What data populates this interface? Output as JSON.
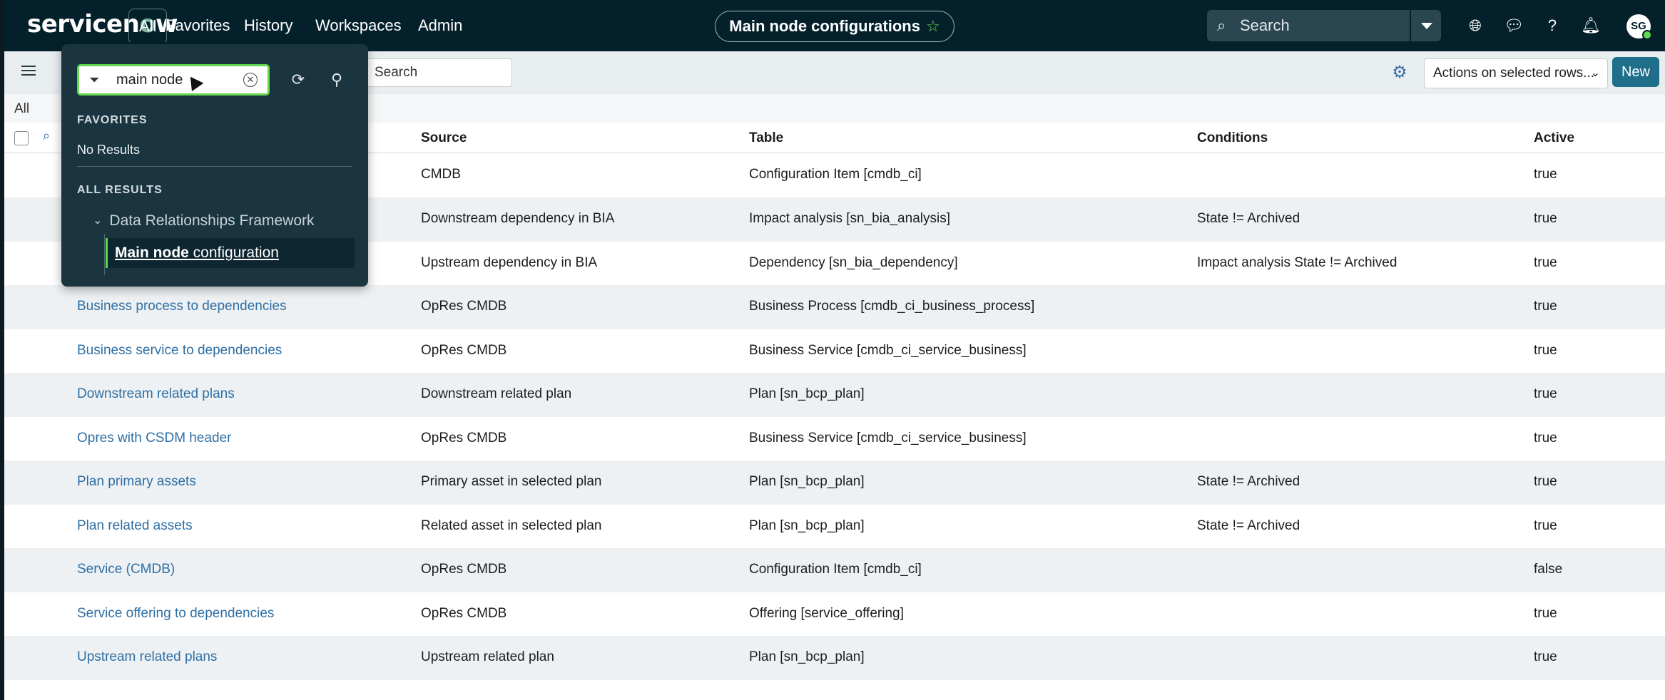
{
  "topnav": {
    "brand": "servicenow",
    "tabs": [
      {
        "label": "All"
      },
      {
        "label": "Favorites"
      },
      {
        "label": "History"
      },
      {
        "label": "Workspaces"
      },
      {
        "label": "Admin"
      }
    ],
    "page_title": "Main node configurations",
    "search_placeholder": "Search",
    "avatar_initials": "SG"
  },
  "toolbar": {
    "list_search_placeholder": "Search",
    "actions_label": "Actions on selected rows...",
    "new_label": "New"
  },
  "breadcrumb": "All",
  "table": {
    "headers": [
      "Source",
      "Table",
      "Conditions",
      "Active"
    ],
    "rows": [
      {
        "name": "",
        "source": "CMDB",
        "table": "Configuration Item [cmdb_ci]",
        "conditions": "",
        "active": "true"
      },
      {
        "name": "",
        "source": "Downstream dependency in BIA",
        "table": "Impact analysis [sn_bia_analysis]",
        "conditions": "State != Archived",
        "active": "true"
      },
      {
        "name": "",
        "source": "Upstream dependency in BIA",
        "table": "Dependency [sn_bia_dependency]",
        "conditions": "Impact analysis State != Archived",
        "active": "true"
      },
      {
        "name": "Business process to dependencies",
        "source": "OpRes CMDB",
        "table": "Business Process [cmdb_ci_business_process]",
        "conditions": "",
        "active": "true"
      },
      {
        "name": "Business service to dependencies",
        "source": "OpRes CMDB",
        "table": "Business Service [cmdb_ci_service_business]",
        "conditions": "",
        "active": "true"
      },
      {
        "name": "Downstream related plans",
        "source": "Downstream related plan",
        "table": "Plan [sn_bcp_plan]",
        "conditions": "",
        "active": "true"
      },
      {
        "name": "Opres with CSDM header",
        "source": "OpRes CMDB",
        "table": "Business Service [cmdb_ci_service_business]",
        "conditions": "",
        "active": "true"
      },
      {
        "name": "Plan primary assets",
        "source": "Primary asset in selected plan",
        "table": "Plan [sn_bcp_plan]",
        "conditions": "State != Archived",
        "active": "true"
      },
      {
        "name": "Plan related assets",
        "source": "Related asset in selected plan",
        "table": "Plan [sn_bcp_plan]",
        "conditions": "State != Archived",
        "active": "true"
      },
      {
        "name": "Service (CMDB)",
        "source": "OpRes CMDB",
        "table": "Configuration Item [cmdb_ci]",
        "conditions": "",
        "active": "false"
      },
      {
        "name": "Service offering to dependencies",
        "source": "OpRes CMDB",
        "table": "Offering [service_offering]",
        "conditions": "",
        "active": "true"
      },
      {
        "name": "Upstream related plans",
        "source": "Upstream related plan",
        "table": "Plan [sn_bcp_plan]",
        "conditions": "",
        "active": "true"
      }
    ]
  },
  "filter_navigator": {
    "query": "main node",
    "favorites_heading": "FAVORITES",
    "no_results": "No Results",
    "all_results_heading": "ALL RESULTS",
    "group": "Data Relationships Framework",
    "item_highlight": "Main node",
    "item_rest": " configuration"
  },
  "colors": {
    "nav_bg": "#04212b",
    "accent_green": "#62d84e",
    "link_blue": "#2f6fa4",
    "new_button": "#1f6f8b"
  }
}
